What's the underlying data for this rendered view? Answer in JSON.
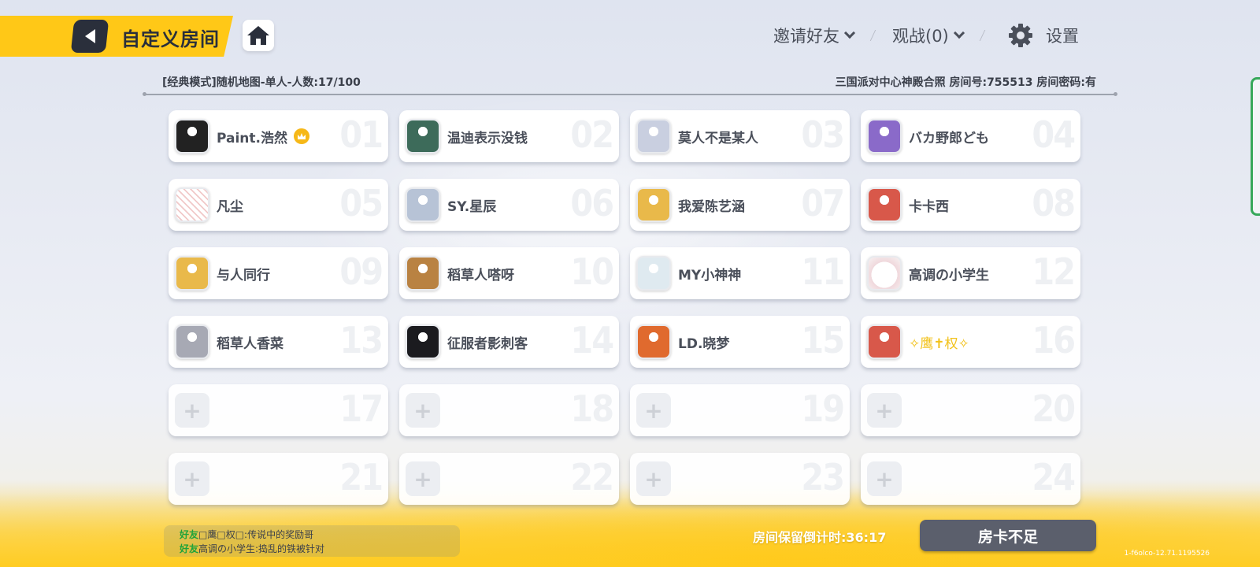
{
  "header": {
    "title": "自定义房间",
    "invite_label": "邀请好友",
    "spectate_label": "观战(0)",
    "settings_label": "设置"
  },
  "room_info": {
    "mode": "[经典模式]随机地图-单人-人数:17/100",
    "details": "三国派对中心神殿合照 房间号:755513 房间密码:有"
  },
  "slots": [
    {
      "num": "01",
      "name": "Paint.浩然",
      "host": true,
      "avatar": "anime-bw",
      "avatar_color": "#222"
    },
    {
      "num": "02",
      "name": "温迪表示没钱",
      "avatar": "anime-green",
      "avatar_color": "#3d6b5a"
    },
    {
      "num": "03",
      "name": "莫人不是某人",
      "avatar": "anime-silver",
      "avatar_color": "#c9cfe0"
    },
    {
      "num": "04",
      "name": "バカ野郎ども",
      "avatar": "anime-purple",
      "avatar_color": "#8a6ac9"
    },
    {
      "num": "05",
      "name": "凡尘",
      "avatar": "doodle",
      "avatar_color": "#f2d6d6"
    },
    {
      "num": "06",
      "name": "SY.星辰",
      "avatar": "anime-pale",
      "avatar_color": "#b7c3d6"
    },
    {
      "num": "07",
      "name": "我爱陈艺涵",
      "avatar": "mascot-yellow",
      "avatar_color": "#e9b94a"
    },
    {
      "num": "08",
      "name": "卡卡西",
      "avatar": "mascot-red",
      "avatar_color": "#d8584a"
    },
    {
      "num": "09",
      "name": "与人同行",
      "avatar": "mascot-yellow",
      "avatar_color": "#e9b94a"
    },
    {
      "num": "10",
      "name": "稻草人嗒呀",
      "avatar": "anime-brown",
      "avatar_color": "#b98242"
    },
    {
      "num": "11",
      "name": "MY小神神",
      "avatar": "anime-light",
      "avatar_color": "#dfeaf0"
    },
    {
      "num": "12",
      "name": "高调の小学生",
      "avatar": "smile-face",
      "avatar_color": "#f7f2f2"
    },
    {
      "num": "13",
      "name": "稻草人香菜",
      "avatar": "anime-grey",
      "avatar_color": "#a7a9b4"
    },
    {
      "num": "14",
      "name": "征服者影刺客",
      "avatar": "dark-hero",
      "avatar_color": "#1b1b1f"
    },
    {
      "num": "15",
      "name": "LD.晓梦",
      "avatar": "mascot-costume",
      "avatar_color": "#e06a2e"
    },
    {
      "num": "16",
      "name": "✧鹰✝权✧",
      "gold": true,
      "avatar": "mascot-red",
      "avatar_color": "#d8584a"
    },
    {
      "num": "17",
      "empty": true
    },
    {
      "num": "18",
      "empty": true
    },
    {
      "num": "19",
      "empty": true
    },
    {
      "num": "20",
      "empty": true
    },
    {
      "num": "21",
      "empty": true
    },
    {
      "num": "22",
      "empty": true
    },
    {
      "num": "23",
      "empty": true
    },
    {
      "num": "24",
      "empty": true
    }
  ],
  "chat": [
    {
      "tag": "好友",
      "text": "□鹰□权□:传说中的奖励哥"
    },
    {
      "tag": "好友",
      "text": "高调の小学生:捣乱的铁被针对"
    }
  ],
  "countdown": "房间保留倒计时:36:17",
  "card_button": "房卡不足",
  "version": "1-f6olco-12.71.1195526",
  "plus_glyph": "+",
  "colors": {
    "accent": "#ffc817",
    "dark": "#2a2f3b",
    "button": "#5b5f6c",
    "friend_tag": "#1ea33a"
  }
}
